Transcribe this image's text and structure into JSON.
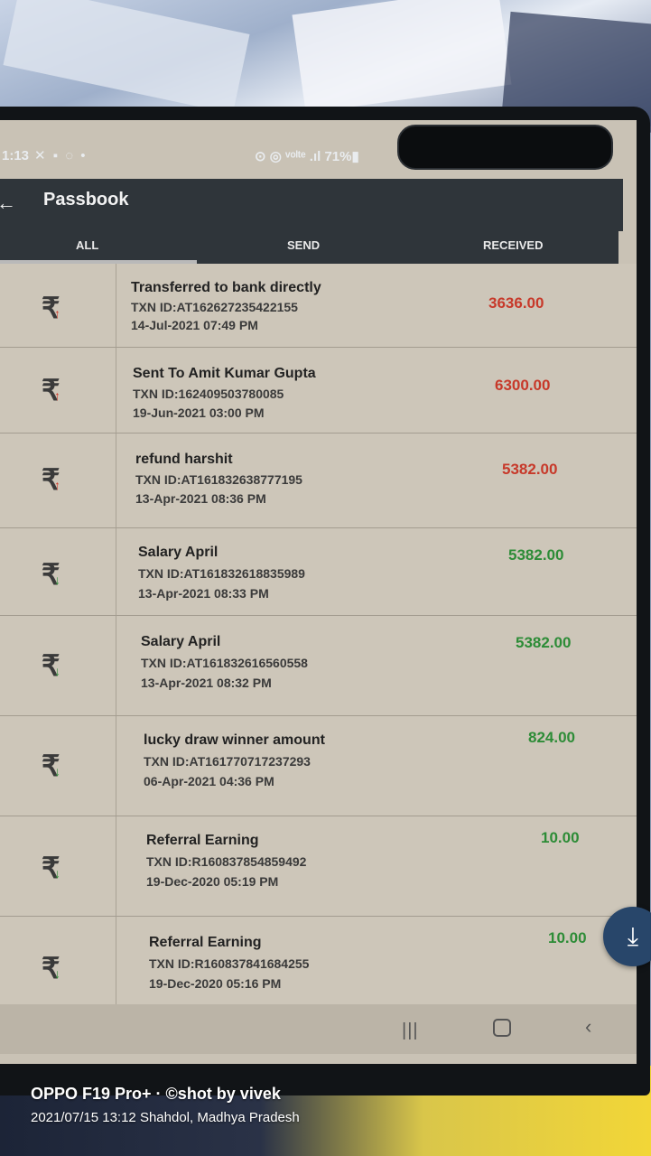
{
  "status_bar": {
    "time": "1:13",
    "left_icons": "✕ ▪ ◌ •",
    "right_text": "⊙ ◎ ᵛᵒˡᵗᵉ .ıl 71%▮"
  },
  "app_bar": {
    "back_icon": "back-arrow-icon",
    "title": "Passbook"
  },
  "tabs": [
    {
      "label": "ALL",
      "active": true
    },
    {
      "label": "SEND",
      "active": false
    },
    {
      "label": "RECEIVED",
      "active": false
    }
  ],
  "transactions": [
    {
      "title": "Transferred to bank directly",
      "txn": "TXN ID:AT162627235422155",
      "date": "14-Jul-2021 07:49 PM",
      "amount": "3636.00",
      "type": "debit"
    },
    {
      "title": "Sent To Amit Kumar Gupta",
      "txn": "TXN ID:162409503780085",
      "date": "19-Jun-2021 03:00 PM",
      "amount": "6300.00",
      "type": "debit"
    },
    {
      "title": "refund harshit",
      "txn": "TXN ID:AT161832638777195",
      "date": "13-Apr-2021 08:36 PM",
      "amount": "5382.00",
      "type": "debit"
    },
    {
      "title": "Salary April",
      "txn": "TXN ID:AT161832618835989",
      "date": "13-Apr-2021 08:33 PM",
      "amount": "5382.00",
      "type": "credit"
    },
    {
      "title": "Salary April",
      "txn": "TXN ID:AT161832616560558",
      "date": "13-Apr-2021 08:32 PM",
      "amount": "5382.00",
      "type": "credit"
    },
    {
      "title": "lucky draw winner amount",
      "txn": "TXN ID:AT161770717237293",
      "date": "06-Apr-2021 04:36 PM",
      "amount": "824.00",
      "type": "credit"
    },
    {
      "title": "Referral Earning",
      "txn": "TXN ID:R160837854859492",
      "date": "19-Dec-2020 05:19 PM",
      "amount": "10.00",
      "type": "credit"
    },
    {
      "title": "Referral Earning",
      "txn": "TXN ID:R160837841684255",
      "date": "19-Dec-2020 05:16 PM",
      "amount": "10.00",
      "type": "credit"
    }
  ],
  "icons": {
    "rupee": "₹",
    "debit_arrow": "↑",
    "credit_arrow": "↓",
    "download": "⤓"
  },
  "nav": {
    "recent": "|||",
    "back": "‹"
  },
  "watermark": {
    "line1": "OPPO F19 Pro+ · ©shot by vivek",
    "line2": "2021/07/15 13:12  Shahdol, Madhya Pradesh"
  },
  "colors": {
    "debit": "#c7392a",
    "credit": "#2d8c37",
    "appbar": "#2f353a",
    "fab": "#28466a"
  }
}
